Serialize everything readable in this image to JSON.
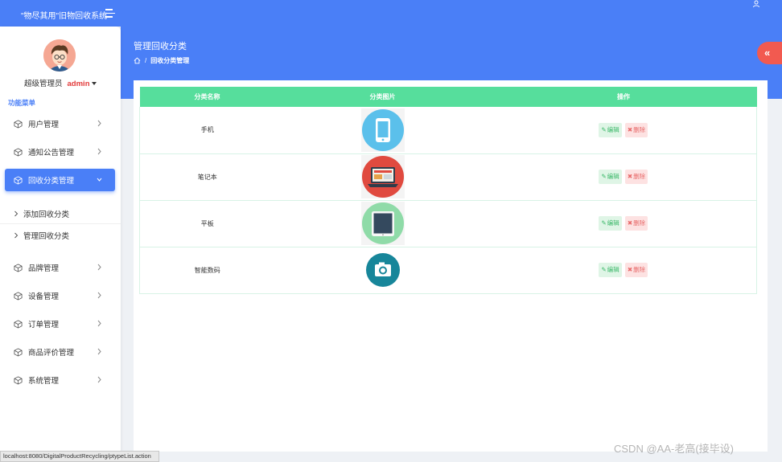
{
  "app": {
    "title": "\"物尽其用\"旧物回收系统"
  },
  "header": {
    "page_title": "管理回收分类",
    "breadcrumb_current": "回收分类管理",
    "collapse_label": "«"
  },
  "sidebar": {
    "role": "超级管理员",
    "username": "admin",
    "section_title": "功能菜单",
    "items": [
      {
        "label": "用户管理"
      },
      {
        "label": "通知公告管理"
      },
      {
        "label": "回收分类管理"
      },
      {
        "label": "品牌管理"
      },
      {
        "label": "设备管理"
      },
      {
        "label": "订单管理"
      },
      {
        "label": "商品评价管理"
      },
      {
        "label": "系统管理"
      }
    ],
    "sub_items": [
      {
        "label": "添加回收分类"
      },
      {
        "label": "管理回收分类"
      }
    ]
  },
  "table": {
    "headers": [
      "分类名称",
      "分类图片",
      "操作"
    ],
    "edit_label": "编辑",
    "delete_label": "删除",
    "rows": [
      {
        "name": "手机",
        "icon": "phone-icon",
        "color": "#5bc0eb"
      },
      {
        "name": "笔记本",
        "icon": "laptop-icon",
        "color": "#e04a3f"
      },
      {
        "name": "平板",
        "icon": "tablet-icon",
        "color": "#8fdba8"
      },
      {
        "name": "智能数码",
        "icon": "camera-icon",
        "color": "#17869a"
      }
    ]
  },
  "status_bar": {
    "url": "localhost:8080/DigitalProductRecycling/ptypeList.action"
  },
  "watermark": "CSDN @AA-老高(接毕设)"
}
